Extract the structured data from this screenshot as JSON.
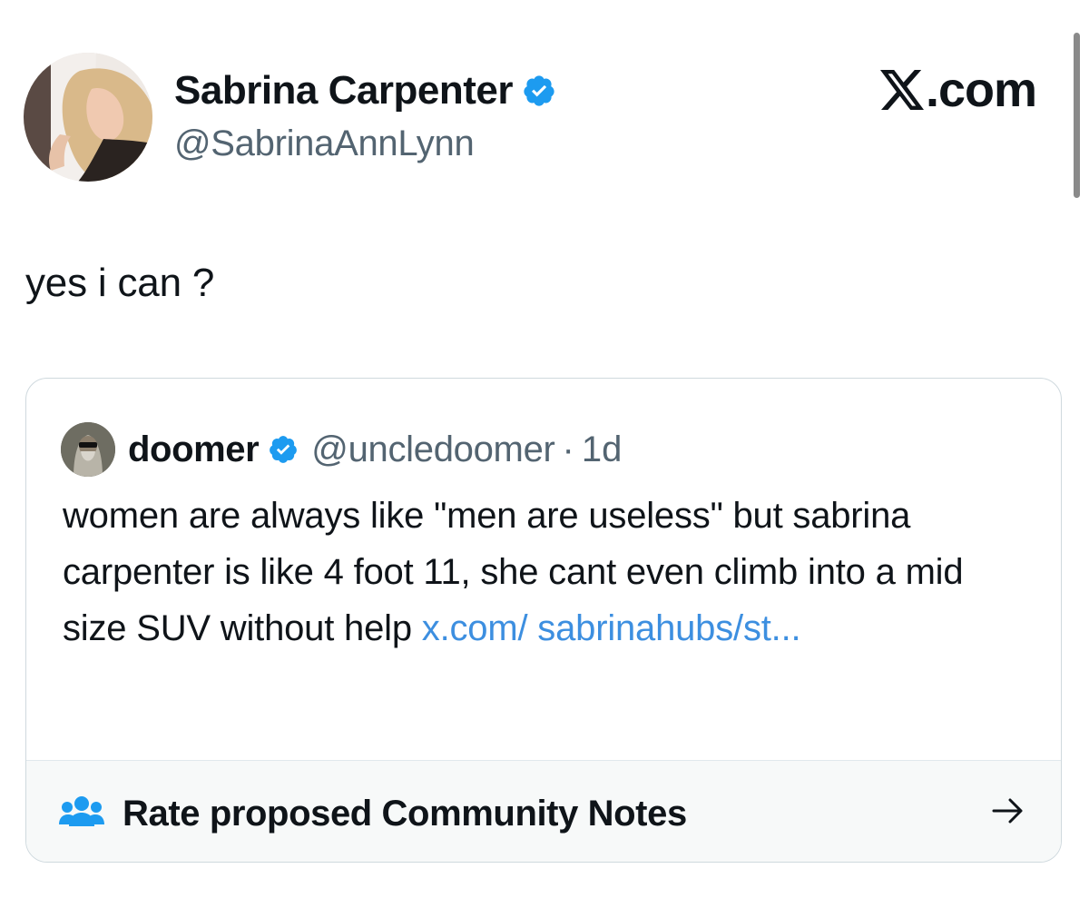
{
  "author": {
    "name": "Sabrina Carpenter",
    "handle": "@SabrinaAnnLynn",
    "verified": true
  },
  "brand": {
    "label": ".com"
  },
  "tweet": {
    "text": "yes i can ?"
  },
  "quoted": {
    "name": "doomer",
    "handle": "@uncledoomer",
    "separator": "·",
    "time": "1d",
    "verified": true,
    "text": "women are always like \"men are useless\" but sabrina carpenter is like 4 foot 11, she cant even climb into a mid size SUV without help ",
    "link": "x.com/ sabrinahubs/st..."
  },
  "community_notes": {
    "label": "Rate proposed Community Notes",
    "icon": "people-icon",
    "arrow_icon": "arrow-right-icon"
  },
  "colors": {
    "verified_blue": "#1d9bf0",
    "link_blue": "#3d8fe0",
    "secondary_text": "#536471"
  }
}
